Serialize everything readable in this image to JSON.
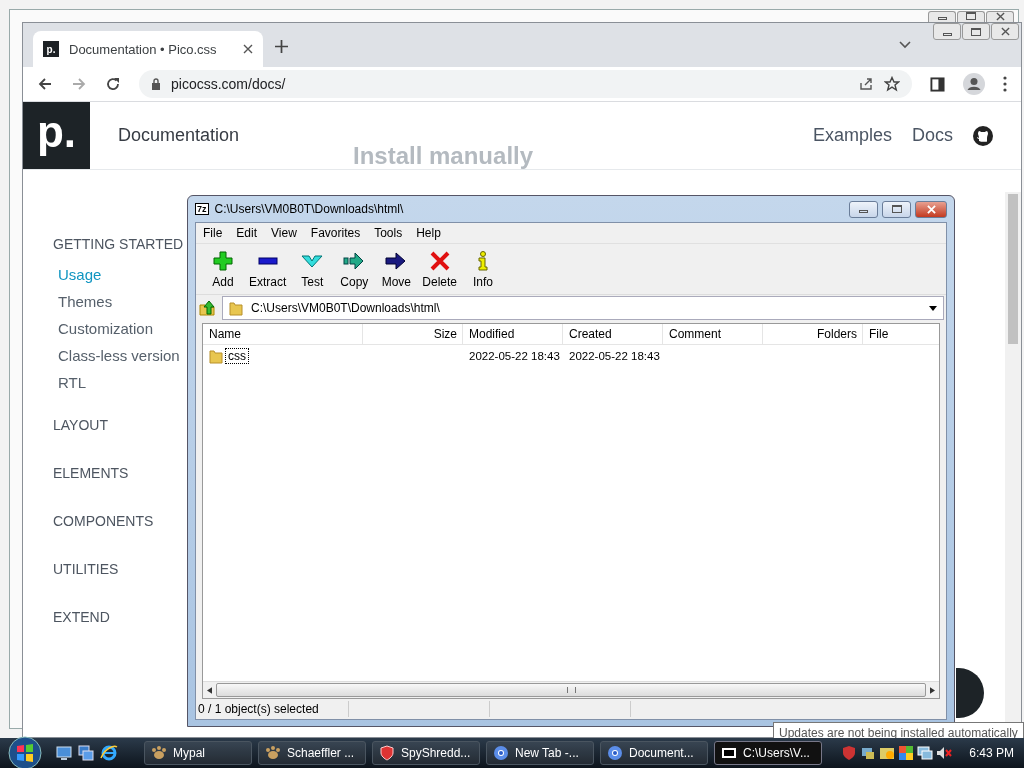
{
  "browser": {
    "tabs": [
      {
        "favicon": "p.",
        "title": "Documentation • Pico.css",
        "selected": true
      }
    ],
    "url": "picocss.com/docs/"
  },
  "page": {
    "logo": "p.",
    "title": "Documentation",
    "nav": [
      "Examples",
      "Docs"
    ],
    "heading": "Install manually",
    "sidebar": [
      {
        "label": "GETTING STARTED",
        "children": [
          {
            "label": "Usage",
            "selected": true
          },
          {
            "label": "Themes",
            "selected": false
          },
          {
            "label": "Customization",
            "selected": false
          },
          {
            "label": "Class-less version",
            "selected": false
          },
          {
            "label": "RTL",
            "selected": false
          }
        ]
      },
      {
        "label": "LAYOUT"
      },
      {
        "label": "ELEMENTS"
      },
      {
        "label": "COMPONENTS"
      },
      {
        "label": "UTILITIES"
      },
      {
        "label": "EXTEND"
      }
    ]
  },
  "archiver": {
    "app_icon": "7z",
    "title": "C:\\Users\\VM0B0T\\Downloads\\html\\",
    "menu": [
      "File",
      "Edit",
      "View",
      "Favorites",
      "Tools",
      "Help"
    ],
    "tools": [
      {
        "label": "Add",
        "kind": "add"
      },
      {
        "label": "Extract",
        "kind": "extract"
      },
      {
        "label": "Test",
        "kind": "test"
      },
      {
        "label": "Copy",
        "kind": "copy"
      },
      {
        "label": "Move",
        "kind": "move"
      },
      {
        "label": "Delete",
        "kind": "delete"
      },
      {
        "label": "Info",
        "kind": "info"
      }
    ],
    "path": "C:\\Users\\VM0B0T\\Downloads\\html\\",
    "columns": [
      "Name",
      "Size",
      "Modified",
      "Created",
      "Comment",
      "Folders",
      "File"
    ],
    "rows": [
      {
        "name": "css",
        "modified": "2022-05-22 18:43",
        "created": "2022-05-22 18:43",
        "focused": true
      }
    ],
    "status": "0 / 1 object(s) selected"
  },
  "tooltip": "Updates are not being installed automatically",
  "taskbar": {
    "tasks": [
      {
        "label": "Mypal",
        "kind": "paw",
        "selected": false
      },
      {
        "label": "Schaeffler ...",
        "kind": "paw",
        "selected": false
      },
      {
        "label": "SpyShredd...",
        "kind": "shield",
        "selected": false
      },
      {
        "label": "New Tab -...",
        "kind": "chrome",
        "selected": false
      },
      {
        "label": "Document...",
        "kind": "chrome",
        "selected": false
      },
      {
        "label": "C:\\Users\\V...",
        "kind": "archive",
        "selected": true
      }
    ],
    "clock": "6:43 PM"
  }
}
